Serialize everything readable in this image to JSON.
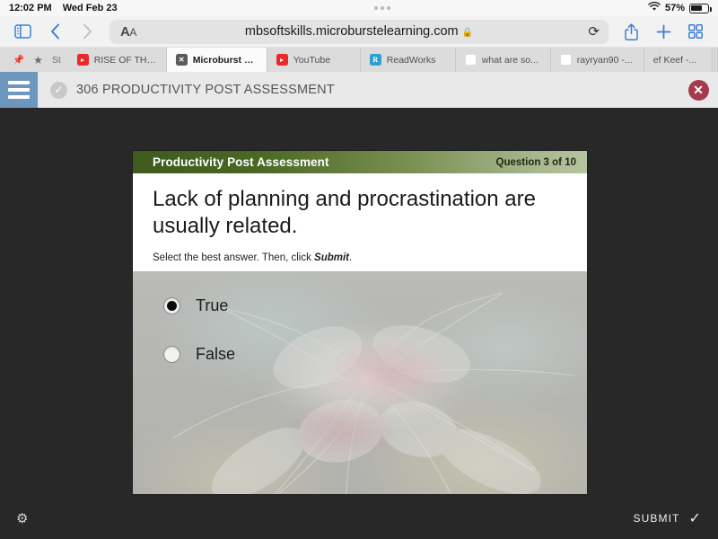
{
  "statusbar": {
    "time": "12:02 PM",
    "date": "Wed Feb 23",
    "battery_percent": "57%",
    "wifi_icon": "wifi-icon",
    "battery_icon": "battery-icon"
  },
  "toolbar": {
    "sidebar_icon": "sidebar-icon",
    "back_icon": "chevron-left-icon",
    "forward_icon": "chevron-right-icon",
    "text_size_label": "AA",
    "url": "mbsoftskills.microburstelearning.com",
    "lock_icon": "lock-icon",
    "reload_icon": "reload-icon",
    "share_icon": "share-icon",
    "new_tab_icon": "plus-icon",
    "tabs_overview_icon": "tab-grid-icon"
  },
  "tabstrip": {
    "pin_icon": "pin-icon",
    "star_icon": "star-icon",
    "star_label": "St",
    "tabs": [
      {
        "label": "RISE OF THE...",
        "favicon": "youtube-icon",
        "active": false
      },
      {
        "label": "Microburst L...",
        "favicon": "microburst-icon",
        "active": true
      },
      {
        "label": "YouTube",
        "favicon": "youtube-icon",
        "active": false
      },
      {
        "label": "ReadWorks",
        "favicon": "readworks-icon",
        "active": false
      },
      {
        "label": "what are so...",
        "favicon": "google-icon",
        "active": false
      },
      {
        "label": "rayryan90 -...",
        "favicon": "google-icon",
        "active": false
      },
      {
        "label": "ef Keef -...",
        "favicon": "none",
        "active": false
      }
    ]
  },
  "app_header": {
    "menu_icon": "hamburger-menu-icon",
    "status_icon": "check-circle-icon",
    "title": "306 PRODUCTIVITY POST ASSESSMENT",
    "close_icon": "close-icon",
    "close_label": "✕",
    "accent_blue": "#6e97bd",
    "close_red": "#a63a4d"
  },
  "slide": {
    "header_title": "Productivity Post Assessment",
    "question_counter": "Question 3 of 10",
    "question_text": "Lack of planning and procrastination are usually related.",
    "hint_before": "Select the best answer. Then, click ",
    "hint_emphasis": "Submit",
    "hint_after": ".",
    "answers": [
      {
        "label": "True",
        "selected": true
      },
      {
        "label": "False",
        "selected": false
      }
    ],
    "header_gradient_start": "#3f5b1d",
    "header_gradient_end": "#b6c49f"
  },
  "bottombar": {
    "settings_icon": "gear-icon",
    "submit_label": "SUBMIT",
    "submit_icon": "check-icon"
  }
}
